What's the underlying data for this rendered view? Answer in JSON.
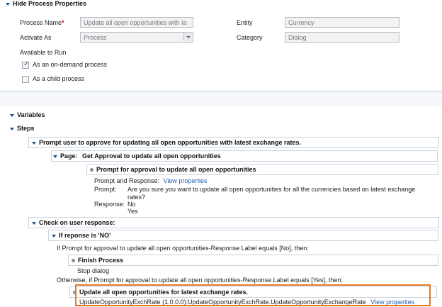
{
  "section": {
    "title": "Hide Process Properties"
  },
  "props": {
    "process_name_label": "Process Name",
    "required_mark": "*",
    "process_name_value": "Update all open opportunities with la",
    "activate_as_label": "Activate As",
    "activate_as_value": "Process",
    "entity_label": "Entity",
    "entity_value": "Currency",
    "category_label": "Category",
    "category_value": "Dialog",
    "available_label": "Available to Run",
    "on_demand_label": "As an on-demand process",
    "on_demand_checked": true,
    "child_label": "As a child process",
    "child_checked": false
  },
  "tree": {
    "variables": "Variables",
    "steps": "Steps",
    "prompt_step": "Prompt user to approve for updating all open opportunities with latest exchange rates.",
    "page_label": "Page:",
    "page_title": "Get Approval to update all open opportunities",
    "prompt_title": "Prompt for approval to update all open opportunities",
    "pr_label": "Prompt and Response:",
    "pr_link": "View properties",
    "prompt_label": "Prompt:",
    "prompt_text_1": "Are you sure you want to update all open opportunities for all the currencies based on latest exchange",
    "prompt_text_2": "rates?",
    "response_label": "Response:",
    "response_no": "No",
    "response_yes": "Yes",
    "check_step": "Check on user response:",
    "if_step": "If reponse is 'NO'",
    "if_condition": "If Prompt for approval to update all open opportunities-Response Label equals [No], then:",
    "finish_title": "Finish Process",
    "finish_desc": "Stop dialog",
    "otherwise_condition": "Otherwise, if Prompt for approval to update all open opportunities-Response Label equals [Yes], then:",
    "update_title": "Update all open opportunities for latest exchange rates.",
    "update_desc": "UpdateOpportunityExchRate (1.0.0.0):UpdateOpportunityExchRate.UpdateOpportunityExchangeRate",
    "update_link": "View properties"
  },
  "colors": {
    "highlight": "#e87722",
    "link": "#1d5fb4",
    "toggle": "#1e4f8c"
  }
}
